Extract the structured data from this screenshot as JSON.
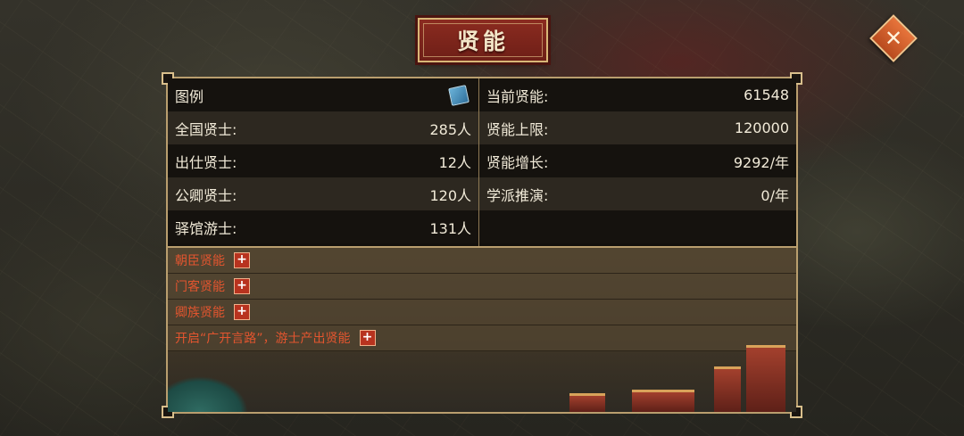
{
  "title": "贤能",
  "close_label": "✕",
  "left_stats": [
    {
      "label": "图例",
      "value": ""
    },
    {
      "label": "全国贤士:",
      "value": "285人"
    },
    {
      "label": "出仕贤士:",
      "value": "12人"
    },
    {
      "label": "公卿贤士:",
      "value": "120人"
    },
    {
      "label": "驿馆游士:",
      "value": "131人"
    }
  ],
  "right_stats": [
    {
      "label": "当前贤能:",
      "value": "61548"
    },
    {
      "label": "贤能上限:",
      "value": "120000"
    },
    {
      "label": "贤能增长:",
      "value": "9292/年"
    },
    {
      "label": "学派推演:",
      "value": "0/年"
    },
    {
      "label": "",
      "value": ""
    }
  ],
  "bonus_items": [
    {
      "label": "朝臣贤能",
      "button": "+"
    },
    {
      "label": "门客贤能",
      "button": "+"
    },
    {
      "label": "卿族贤能",
      "button": "+"
    },
    {
      "label": "开启“广开言路”，游士产出贤能",
      "button": "+"
    }
  ],
  "icons": {
    "legend": "book-icon",
    "close": "close-icon"
  },
  "colors": {
    "title_bg": "#8b2b20",
    "bonus_text": "#e2552f",
    "plus_button": "#b8331f",
    "close_button": "#d9622c"
  }
}
